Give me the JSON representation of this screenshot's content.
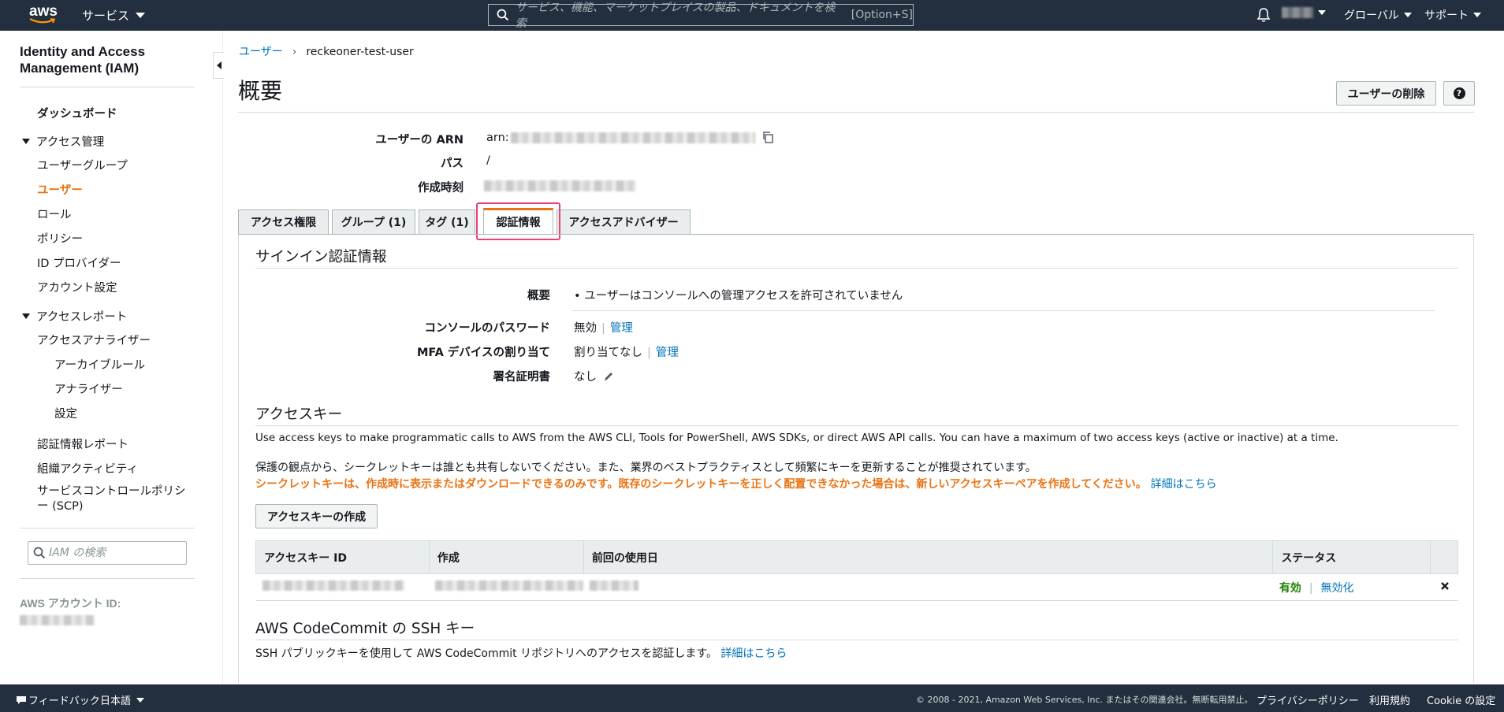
{
  "topnav": {
    "logo": "aws",
    "services_label": "サービス",
    "search_placeholder": "サービス、機能、マーケットプレイスの製品、ドキュメントを検索",
    "search_shortcut": "[Option+S]",
    "region_label": "グローバル",
    "support_label": "サポート"
  },
  "sidebar": {
    "title": "Identity and Access Management (IAM)",
    "dashboard": "ダッシュボード",
    "access_mgmt_group": "アクセス管理",
    "access_mgmt_items": [
      "ユーザーグループ",
      "ユーザー",
      "ロール",
      "ポリシー",
      "ID プロバイダー",
      "アカウント設定"
    ],
    "access_report_group": "アクセスレポート",
    "access_analyzer": "アクセスアナライザー",
    "analyzer_subitems": [
      "アーカイブルール",
      "アナライザー",
      "設定"
    ],
    "other_items": [
      "認証情報レポート",
      "組織アクティビティ",
      "サービスコントロールポリシー (SCP)"
    ],
    "search_placeholder": "IAM の検索",
    "account_id_label": "AWS アカウント ID:"
  },
  "breadcrumb": {
    "parent": "ユーザー",
    "current": "reckeoner-test-user"
  },
  "page": {
    "title": "概要",
    "delete_button": "ユーザーの削除",
    "help_button": "?"
  },
  "summary": {
    "arn_label": "ユーザーの ARN",
    "arn_prefix": "arn:",
    "path_label": "パス",
    "path_value": "/",
    "created_label": "作成時刻"
  },
  "tabs": [
    {
      "label": "アクセス権限",
      "active": false
    },
    {
      "label": "グループ (1)",
      "active": false
    },
    {
      "label": "タグ (1)",
      "active": false
    },
    {
      "label": "認証情報",
      "active": true
    },
    {
      "label": "アクセスアドバイザー",
      "active": false
    }
  ],
  "signin": {
    "title": "サインイン認証情報",
    "overview_label": "概要",
    "overview_value": "ユーザーはコンソールへの管理アクセスを許可されていません",
    "console_password_label": "コンソールのパスワード",
    "console_password_value": "無効",
    "manage_link": "管理",
    "mfa_label": "MFA デバイスの割り当て",
    "mfa_value": "割り当てなし",
    "cert_label": "署名証明書",
    "cert_value": "なし"
  },
  "access_keys": {
    "title": "アクセスキー",
    "description": "Use access keys to make programmatic calls to AWS from the AWS CLI, Tools for PowerShell, AWS SDKs, or direct AWS API calls. You can have a maximum of two access keys (active or inactive) at a time.",
    "security_note": "保護の観点から、シークレットキーは誰とも共有しないでください。また、業界のベストプラクティスとして頻繁にキーを更新することが推奨されています。",
    "warning": "シークレットキーは、作成時に表示またはダウンロードできるのみです。既存のシークレットキーを正しく配置できなかった場合は、新しいアクセスキーペアを作成してください。",
    "learn_more": "詳細はこちら",
    "create_button": "アクセスキーの作成",
    "columns": [
      "アクセスキー ID",
      "作成",
      "前回の使用日",
      "ステータス"
    ],
    "rows": [
      {
        "status": "有効",
        "action": "無効化"
      }
    ]
  },
  "codecommit": {
    "title": "AWS CodeCommit の SSH キー",
    "description": "SSH パブリックキーを使用して AWS CodeCommit リポジトリへのアクセスを認証します。",
    "learn_more": "詳細はこちら"
  },
  "footer": {
    "feedback": "フィードバック",
    "language": "日本語",
    "copyright": "© 2008 - 2021, Amazon Web Services, Inc. またはその関連会社。無断転用禁止。",
    "privacy": "プライバシーポリシー",
    "terms": "利用規約",
    "cookie": "Cookie の設定"
  },
  "colors": {
    "nav_bg": "#232f3e",
    "accent_orange": "#ec7211",
    "link_blue": "#0073bb",
    "active_green": "#1d8102",
    "tab_highlight": "#e8417d"
  }
}
